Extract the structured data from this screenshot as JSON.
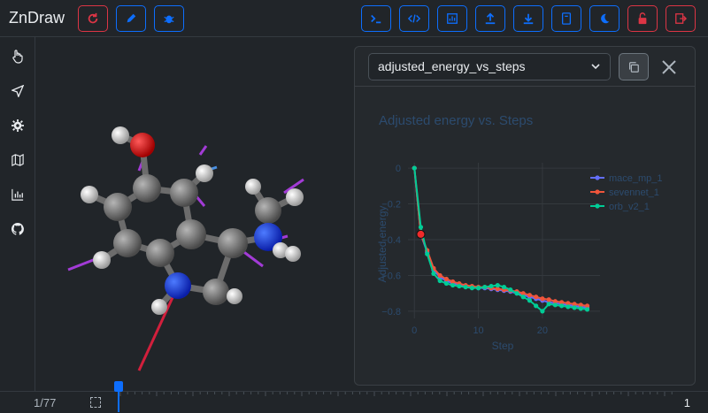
{
  "app": {
    "brand": "ZnDraw"
  },
  "navbar": {
    "left_buttons": [
      {
        "name": "refresh-button",
        "icon": "refresh-icon",
        "color": "#dc3545"
      },
      {
        "name": "edit-button",
        "icon": "pencil-icon",
        "color": "#0d6efd"
      },
      {
        "name": "bug-button",
        "icon": "bug-icon",
        "color": "#0d6efd"
      }
    ],
    "right_buttons": [
      {
        "name": "terminal-button",
        "icon": "terminal-icon"
      },
      {
        "name": "code-button",
        "icon": "code-icon"
      },
      {
        "name": "analysis-button",
        "icon": "analysis-icon"
      },
      {
        "name": "upload-button",
        "icon": "upload-icon"
      },
      {
        "name": "download-button",
        "icon": "download-icon"
      },
      {
        "name": "docs-button",
        "icon": "book-icon"
      },
      {
        "name": "theme-button",
        "icon": "moon-icon"
      },
      {
        "name": "lock-button",
        "icon": "unlock-icon"
      },
      {
        "name": "logout-button",
        "icon": "exit-icon"
      }
    ]
  },
  "sidebar": {
    "items": [
      {
        "name": "sidebar-item-selection",
        "icon": "hand-pointer-icon"
      },
      {
        "name": "sidebar-item-interaction",
        "icon": "send-icon"
      },
      {
        "name": "sidebar-item-settings",
        "icon": "gear-icon"
      },
      {
        "name": "sidebar-item-geometry",
        "icon": "map-icon"
      },
      {
        "name": "sidebar-item-analysis",
        "icon": "bar-chart-icon"
      },
      {
        "name": "sidebar-item-github",
        "icon": "github-icon"
      }
    ]
  },
  "plot_panel": {
    "selected_plot": "adjusted_energy_vs_steps",
    "copy_icon": "copy-icon",
    "close_icon": "close-icon"
  },
  "timeline": {
    "frame_label": "1/77",
    "end_label": "1"
  },
  "colors": {
    "accent": "#0d6efd",
    "danger": "#dc3545",
    "series_mace": "#636efa",
    "series_sevennet": "#ef553b",
    "series_orb": "#00cc96"
  },
  "chart_data": {
    "type": "line",
    "title": "Adjusted energy vs. Steps",
    "xlabel": "Step",
    "ylabel": "Adjusted energy",
    "xlim": [
      -1,
      29
    ],
    "ylim": [
      -0.84,
      0.03
    ],
    "xticks": [
      0,
      10,
      20
    ],
    "yticks": [
      0,
      -0.2,
      -0.4,
      -0.6,
      -0.8
    ],
    "ytick_labels": [
      "0",
      "−0.2",
      "−0.4",
      "−0.6",
      "−0.8"
    ],
    "grid": true,
    "legend": "top-right",
    "highlight": {
      "x": 1,
      "y": -0.37
    },
    "series": [
      {
        "name": "mace_mp_1",
        "color": "#636efa",
        "x": [
          0,
          1,
          2,
          3,
          4,
          5,
          6,
          7,
          8,
          9,
          10,
          11,
          12,
          13,
          14,
          15,
          16,
          17,
          18,
          19,
          20,
          21,
          22,
          23,
          24,
          25,
          26,
          27
        ],
        "y": [
          0,
          -0.37,
          -0.47,
          -0.57,
          -0.61,
          -0.63,
          -0.645,
          -0.65,
          -0.66,
          -0.665,
          -0.67,
          -0.67,
          -0.675,
          -0.68,
          -0.685,
          -0.69,
          -0.7,
          -0.71,
          -0.72,
          -0.73,
          -0.74,
          -0.75,
          -0.755,
          -0.76,
          -0.765,
          -0.77,
          -0.775,
          -0.78
        ]
      },
      {
        "name": "sevennet_1",
        "color": "#ef553b",
        "x": [
          0,
          1,
          2,
          3,
          4,
          5,
          6,
          7,
          8,
          9,
          10,
          11,
          12,
          13,
          14,
          15,
          16,
          17,
          18,
          19,
          20,
          21,
          22,
          23,
          24,
          25,
          26,
          27
        ],
        "y": [
          0,
          -0.37,
          -0.46,
          -0.56,
          -0.6,
          -0.62,
          -0.635,
          -0.645,
          -0.655,
          -0.66,
          -0.665,
          -0.665,
          -0.67,
          -0.675,
          -0.68,
          -0.685,
          -0.69,
          -0.7,
          -0.71,
          -0.72,
          -0.73,
          -0.735,
          -0.745,
          -0.75,
          -0.755,
          -0.76,
          -0.765,
          -0.77
        ]
      },
      {
        "name": "orb_v2_1",
        "color": "#00cc96",
        "x": [
          0,
          1,
          2,
          3,
          4,
          5,
          6,
          7,
          8,
          9,
          10,
          11,
          12,
          13,
          14,
          15,
          16,
          17,
          18,
          19,
          20,
          21,
          22,
          23,
          24,
          25,
          26,
          27
        ],
        "y": [
          0,
          -0.33,
          -0.48,
          -0.59,
          -0.63,
          -0.645,
          -0.655,
          -0.66,
          -0.665,
          -0.67,
          -0.67,
          -0.665,
          -0.66,
          -0.655,
          -0.665,
          -0.68,
          -0.7,
          -0.72,
          -0.74,
          -0.77,
          -0.8,
          -0.76,
          -0.765,
          -0.77,
          -0.775,
          -0.78,
          -0.785,
          -0.79
        ]
      }
    ]
  }
}
